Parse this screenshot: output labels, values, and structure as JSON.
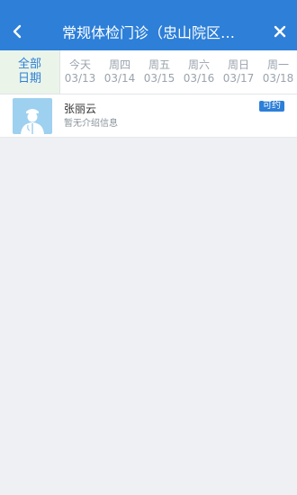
{
  "header": {
    "title": "常规体检门诊（忠山院区…",
    "back_icon": "chevron-left-icon",
    "close_icon": "close-icon"
  },
  "date_tabs": {
    "all": {
      "line1": "全部",
      "line2": "日期"
    },
    "days": [
      {
        "weekday": "今天",
        "date": "03/13"
      },
      {
        "weekday": "周四",
        "date": "03/14"
      },
      {
        "weekday": "周五",
        "date": "03/15"
      },
      {
        "weekday": "周六",
        "date": "03/16"
      },
      {
        "weekday": "周日",
        "date": "03/17"
      },
      {
        "weekday": "周一",
        "date": "03/18"
      }
    ]
  },
  "doctors": [
    {
      "name": "张丽云",
      "description": "暂无介绍信息",
      "badge": "可约",
      "avatar_icon": "doctor-avatar-icon"
    }
  ],
  "colors": {
    "primary": "#2d7fd8",
    "background": "#eef0f3",
    "tab_all_bg": "#eaf4e9",
    "avatar_bg": "#9ed0f0"
  }
}
